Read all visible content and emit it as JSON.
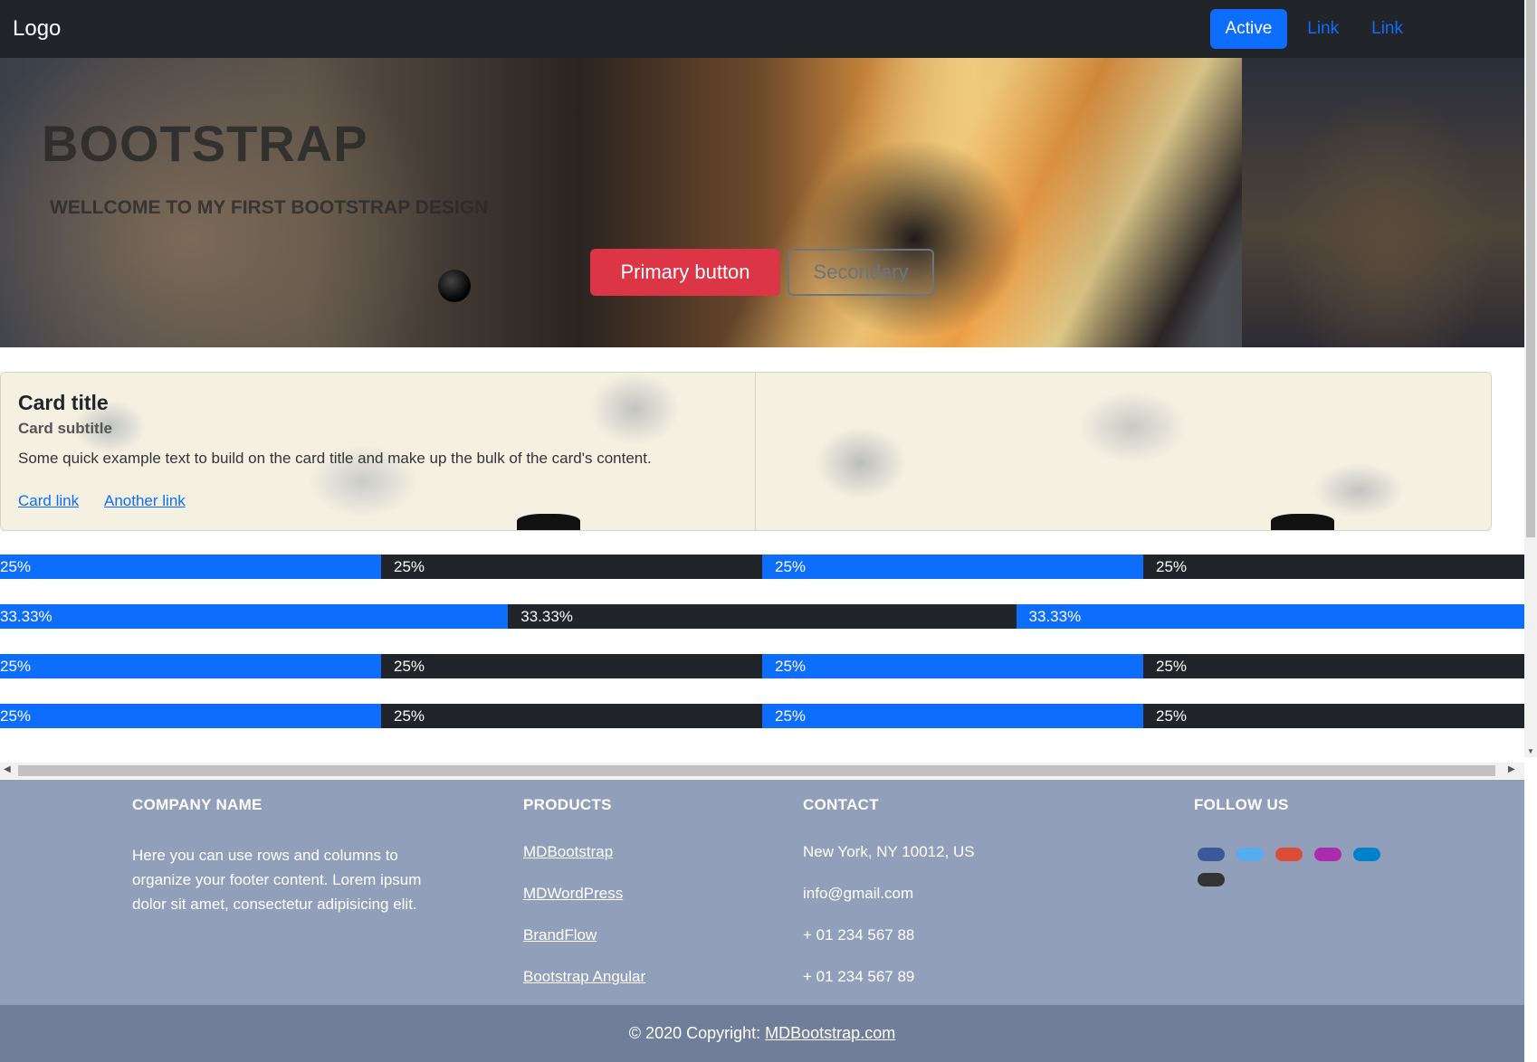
{
  "navbar": {
    "brand": "Logo",
    "links": [
      "Active",
      "Link",
      "Link"
    ]
  },
  "hero": {
    "title": "BOOTSTRAP",
    "subtitle": "WELLCOME TO MY FIRST BOOTSTRAP DESIGN",
    "primary_button": "Primary button",
    "secondary_button": "Secondary"
  },
  "card": {
    "title": "Card title",
    "subtitle": "Card subtitle",
    "text": "Some quick example text to build on the card title and make up the bulk of the card's content.",
    "links": [
      "Card link",
      "Another link"
    ]
  },
  "progress_rows": [
    {
      "segments": [
        {
          "label": "25%",
          "value": 25,
          "color": "blue"
        },
        {
          "label": "25%",
          "value": 25,
          "color": "dark"
        },
        {
          "label": "25%",
          "value": 25,
          "color": "blue"
        },
        {
          "label": "25%",
          "value": 25,
          "color": "dark"
        }
      ]
    },
    {
      "segments": [
        {
          "label": "33.33%",
          "value": 33.33,
          "color": "blue"
        },
        {
          "label": "33.33%",
          "value": 33.33,
          "color": "dark"
        },
        {
          "label": "33.33%",
          "value": 33.33,
          "color": "blue"
        }
      ]
    },
    {
      "segments": [
        {
          "label": "25%",
          "value": 25,
          "color": "blue"
        },
        {
          "label": "25%",
          "value": 25,
          "color": "dark"
        },
        {
          "label": "25%",
          "value": 25,
          "color": "blue"
        },
        {
          "label": "25%",
          "value": 25,
          "color": "dark"
        }
      ]
    },
    {
      "segments": [
        {
          "label": "25%",
          "value": 25,
          "color": "blue"
        },
        {
          "label": "25%",
          "value": 25,
          "color": "dark"
        },
        {
          "label": "25%",
          "value": 25,
          "color": "blue"
        },
        {
          "label": "25%",
          "value": 25,
          "color": "dark"
        }
      ]
    }
  ],
  "footer": {
    "company_heading": "COMPANY NAME",
    "company_text": "Here you can use rows and columns to organize your footer content. Lorem ipsum dolor sit amet, consectetur adipisicing elit.",
    "products_heading": "PRODUCTS",
    "products": [
      "MDBootstrap",
      "MDWordPress",
      "BrandFlow",
      "Bootstrap Angular"
    ],
    "contact_heading": "CONTACT",
    "contact": [
      "New York, NY 10012, US",
      "info@gmail.com",
      "+ 01 234 567 88",
      "+ 01 234 567 89"
    ],
    "follow_heading": "FOLLOW US",
    "social": [
      {
        "icon": "facebook-icon",
        "color": "#3b5998"
      },
      {
        "icon": "twitter-icon",
        "color": "#55acee"
      },
      {
        "icon": "google-icon",
        "color": "#dd4b39"
      },
      {
        "icon": "instagram-icon",
        "color": "#ac2bac"
      },
      {
        "icon": "linkedin-icon",
        "color": "#0082ca"
      },
      {
        "icon": "github-icon",
        "color": "#333333"
      }
    ]
  },
  "copyright": {
    "prefix": "© 2020 Copyright: ",
    "link": "MDBootstrap.com"
  },
  "colors": {
    "primary": "#0d6efd",
    "danger": "#dc3545",
    "dark": "#212529",
    "footer_bg": "#919fba",
    "copyright_bg": "#707e99"
  }
}
